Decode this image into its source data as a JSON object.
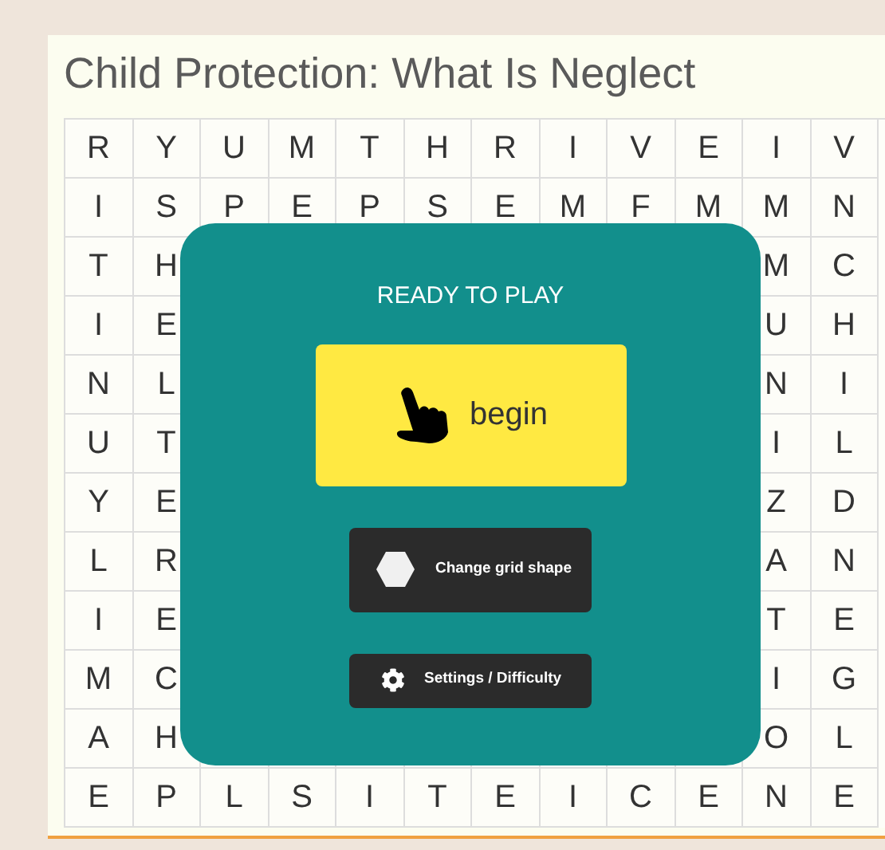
{
  "title": "Child Protection: What Is Neglect",
  "grid": {
    "rows": [
      [
        "R",
        "Y",
        "U",
        "M",
        "T",
        "H",
        "R",
        "I",
        "V",
        "E",
        "I",
        "V"
      ],
      [
        "I",
        "S",
        "P",
        "E",
        "P",
        "S",
        "E",
        "M",
        "F",
        "M",
        "M",
        "N"
      ],
      [
        "T",
        "H",
        null,
        null,
        null,
        null,
        null,
        null,
        null,
        null,
        "M",
        "C"
      ],
      [
        "I",
        "E",
        null,
        null,
        null,
        null,
        null,
        null,
        null,
        null,
        "U",
        "H"
      ],
      [
        "N",
        "L",
        null,
        null,
        null,
        null,
        null,
        null,
        null,
        null,
        "N",
        "I"
      ],
      [
        "U",
        "T",
        null,
        null,
        null,
        null,
        null,
        null,
        null,
        null,
        "I",
        "L"
      ],
      [
        "Y",
        "E",
        null,
        null,
        null,
        null,
        null,
        null,
        null,
        null,
        "Z",
        "D"
      ],
      [
        "L",
        "R",
        null,
        null,
        null,
        null,
        null,
        null,
        null,
        null,
        "A",
        "N"
      ],
      [
        "I",
        "E",
        null,
        null,
        null,
        null,
        null,
        null,
        null,
        null,
        "T",
        "E"
      ],
      [
        "M",
        "C",
        null,
        null,
        null,
        null,
        null,
        null,
        null,
        null,
        "I",
        "G"
      ],
      [
        "A",
        "H",
        null,
        null,
        null,
        null,
        null,
        null,
        null,
        null,
        "O",
        "L"
      ],
      [
        "E",
        "P",
        "L",
        "S",
        "I",
        "T",
        "E",
        "I",
        "C",
        "E",
        "N",
        "E"
      ]
    ]
  },
  "overlay": {
    "heading": "READY TO PLAY",
    "buttons": [
      {
        "kind": "primary",
        "label": "begin"
      },
      {
        "kind": "shape",
        "label": "Change grid shape"
      },
      {
        "kind": "settings",
        "label": "Settings / Difficulty"
      }
    ]
  }
}
